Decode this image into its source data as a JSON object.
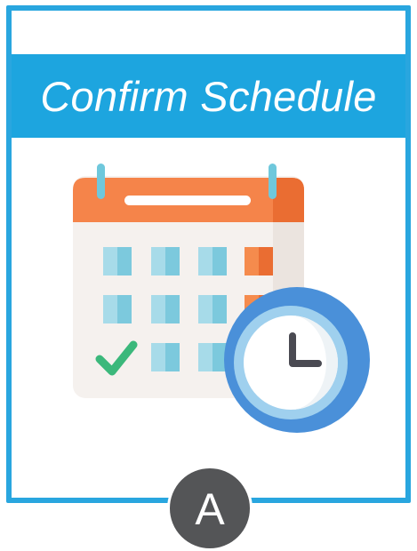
{
  "card": {
    "title": "Confirm Schedule",
    "illustration_icon": "calendar-clock-icon",
    "checkmark_icon": "checkmark-icon"
  },
  "badge": {
    "letter": "A"
  },
  "colors": {
    "accent": "#1da5df",
    "badge": "#545557",
    "calendar_header": "#f07d3e",
    "calendar_body": "#f5f1ee",
    "clock_ring": "#4a90d9",
    "check": "#3bb87b"
  }
}
